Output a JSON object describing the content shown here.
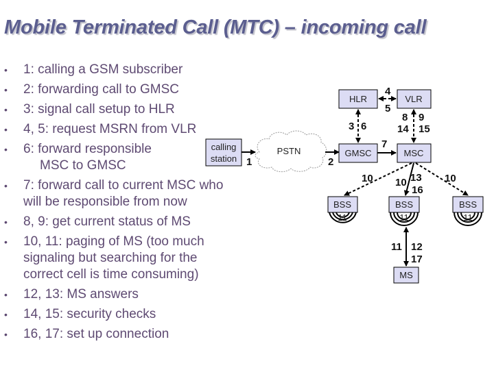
{
  "slide": {
    "title": "Mobile Terminated Call (MTC) – incoming call",
    "title_color": "#5b5e8f",
    "text_color": "#5e4a72",
    "bullet_glyph": "•",
    "bullets": [
      {
        "lines": [
          "1: calling a GSM subscriber"
        ]
      },
      {
        "lines": [
          "2: forwarding call to GMSC"
        ]
      },
      {
        "lines": [
          "3: signal call setup to HLR"
        ]
      },
      {
        "lines": [
          "4, 5: request MSRN from VLR"
        ]
      },
      {
        "lines": [
          "6: forward responsible",
          "MSC to GMSC"
        ]
      },
      {
        "lines": [
          "7: forward call to current MSC who",
          "will be responsible from now"
        ]
      },
      {
        "lines": [
          "8, 9: get current status of MS"
        ]
      },
      {
        "lines": [
          "10, 11: paging of MS (too much",
          "signaling but searching for the",
          "correct cell is time consuming)"
        ]
      },
      {
        "lines": [
          "12, 13: MS answers"
        ]
      },
      {
        "lines": [
          "14, 15: security checks"
        ]
      },
      {
        "lines": [
          "16, 17: set up connection"
        ]
      }
    ]
  },
  "diagram": {
    "box_fill": "#dcdcf4",
    "nodes": {
      "calling_station": [
        "calling",
        "station"
      ],
      "pstn": "PSTN",
      "hlr": "HLR",
      "vlr": "VLR",
      "gmsc": "GMSC",
      "msc": "MSC",
      "bss": "BSS",
      "ms": "MS"
    },
    "labels": {
      "step1": "1",
      "step2": "2",
      "step3": "3",
      "step6": "6",
      "step4": "4",
      "step5": "5",
      "step7": "7",
      "step8": "8",
      "step9": "9",
      "step14": "14",
      "step15": "15",
      "step10_left": "10",
      "step10_mid": "10",
      "step13": "13",
      "step16": "16",
      "step10_right": "10",
      "step11_bss": "11",
      "step11_ms": "11",
      "step12": "12",
      "step17": "17"
    }
  }
}
